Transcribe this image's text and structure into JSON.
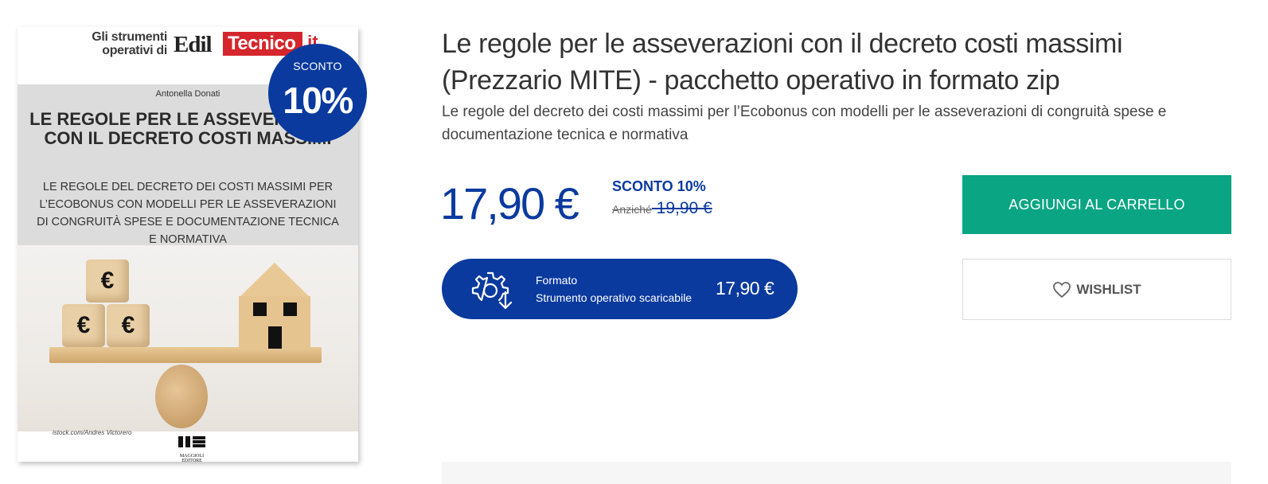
{
  "cover": {
    "series_label": "Gli strumenti operativi di",
    "logo_part1": "Edil",
    "logo_part2": "Tecnico",
    "logo_part3": ".it",
    "author": "Antonella Donati",
    "title": "LE REGOLE PER LE ASSEVERAZIONI CON IL DECRETO COSTI MASSIMI",
    "subtitle": "LE REGOLE DEL DECRETO DEI COSTI MASSIMI PER L’ECOBONUS CON MODELLI PER LE ASSEVERAZIONI DI CONGRUITÀ SPESE E DOCUMENTAZIONE TECNICA E NORMATIVA",
    "photo_credit": "istock.com/Andres Victorero",
    "publisher": "MAGGIOLI EDITORE",
    "cube_symbol": "€"
  },
  "badge": {
    "label": "SCONTO",
    "value": "10%"
  },
  "product": {
    "title": "Le regole per le asseverazioni con il decreto costi massimi (Prezzario MITE) - pacchetto operativo in formato zip",
    "subtitle": "Le regole del decreto dei costi massimi per l’Ecobonus con modelli per le asseverazioni di congruità spese e documentazione tecnica e normativa"
  },
  "pricing": {
    "price": "17,90 €",
    "discount": "SCONTO 10%",
    "old_prefix": "Anziché",
    "old_price": " 19,90 €"
  },
  "format": {
    "label": "Formato",
    "type": "Strumento operativo scaricabile",
    "price": "17,90 €",
    "icon": "gear-download-icon"
  },
  "actions": {
    "add_to_cart": "AGGIUNGI AL CARRELLO",
    "wishlist": "WISHLIST"
  },
  "colors": {
    "brand_blue": "#0a3a9e",
    "cart_green": "#0aa583",
    "logo_red": "#d4262c"
  }
}
